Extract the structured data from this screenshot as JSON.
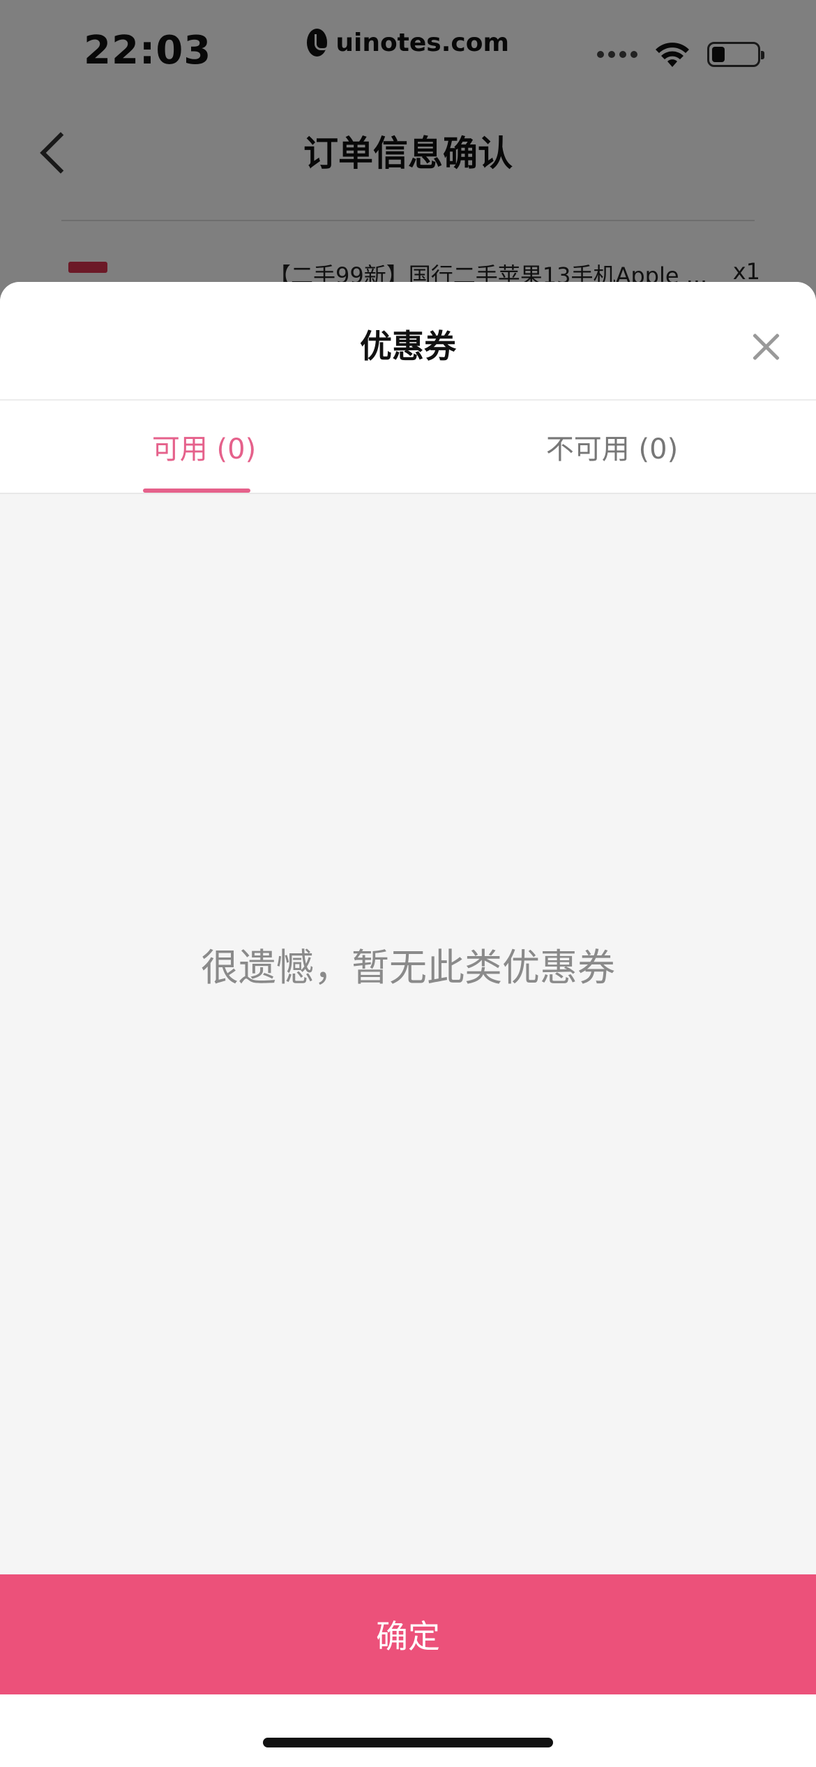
{
  "status_bar": {
    "time": "22:03",
    "watermark": "uinotes.com"
  },
  "nav": {
    "title": "订单信息确认"
  },
  "background_product": {
    "title": "【二手99新】国行二手苹果13手机Apple ...",
    "quantity": "x1"
  },
  "sheet": {
    "title": "优惠券",
    "tabs": [
      {
        "label": "可用 (0)",
        "active": true
      },
      {
        "label": "不可用 (0)",
        "active": false
      }
    ],
    "empty_message": "很遗憾，暂无此类优惠券",
    "confirm_label": "确定"
  },
  "colors": {
    "accent": "#e5618b",
    "button": "#ec517a",
    "overlay": "rgba(0,0,0,0.5)"
  }
}
